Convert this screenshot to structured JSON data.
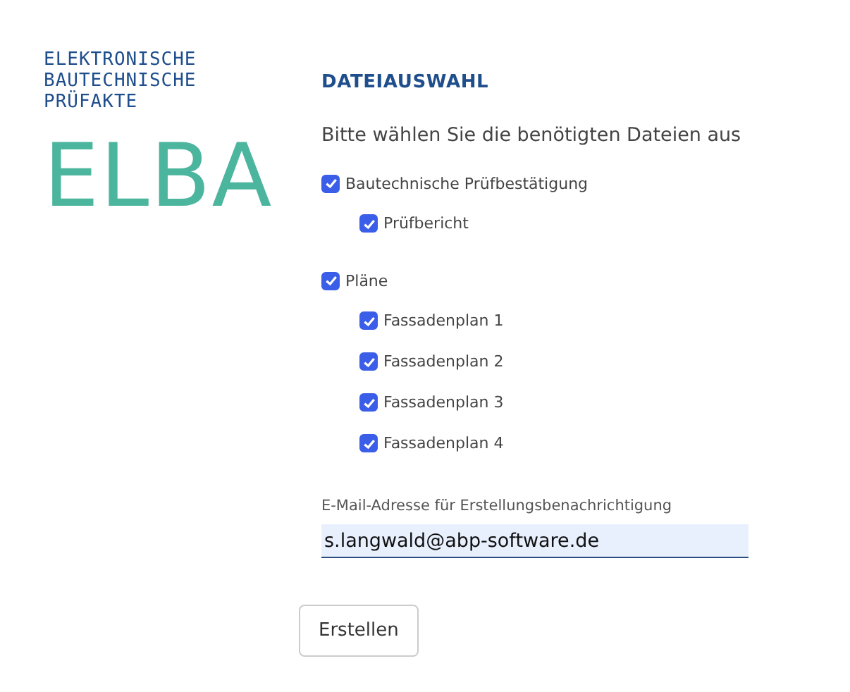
{
  "logo": {
    "subtitle_lines": [
      "ELEKTRONISCHE",
      "BAUTECHNISCHE",
      "PRÜFAKTE"
    ],
    "wordmark": "ELBA"
  },
  "heading": "DATEIAUSWAHL",
  "intro": "Bitte wählen Sie die benötigten Dateien aus",
  "groups": [
    {
      "label": "Bautechnische Prüfbestätigung",
      "checked": true,
      "children": [
        {
          "label": "Prüfbericht",
          "checked": true
        }
      ]
    },
    {
      "label": "Pläne",
      "checked": true,
      "children": [
        {
          "label": "Fassadenplan 1",
          "checked": true
        },
        {
          "label": "Fassadenplan 2",
          "checked": true
        },
        {
          "label": "Fassadenplan 3",
          "checked": true
        },
        {
          "label": "Fassadenplan 4",
          "checked": true
        }
      ]
    }
  ],
  "email": {
    "label": "E-Mail-Adresse für Erstellungsbenachrichtigung",
    "value": "s.langwald@abp-software.de"
  },
  "submit": "Erstellen"
}
